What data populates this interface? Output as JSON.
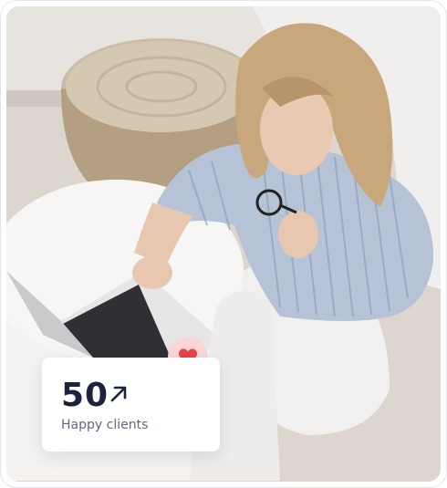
{
  "stat": {
    "number": "50",
    "label": "Happy clients",
    "arrow_icon": "arrow-up-right-icon"
  },
  "badge": {
    "icon": "heart-icon",
    "color": "#e8434b",
    "background": "#fcd6d6"
  }
}
